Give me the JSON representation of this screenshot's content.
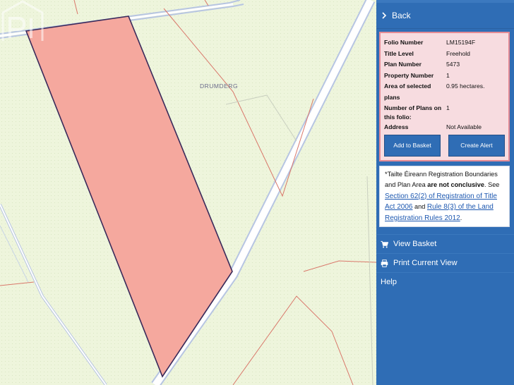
{
  "map": {
    "townland_label": "DRUMDERG",
    "colors": {
      "background": "#eef5dc",
      "plot_fill": "#f5a89e",
      "plot_border": "#3a2a5a",
      "road": "#b7c5e2",
      "boundary": "#d9776a"
    },
    "watermark_icon": "ppr-logo-watermark"
  },
  "panel": {
    "back_label": "Back",
    "folio": {
      "rows": [
        {
          "label": "Folio Number",
          "value": "LM15194F"
        },
        {
          "label": "Title Level",
          "value": "Freehold"
        },
        {
          "label": "Plan Number",
          "value": "5473"
        },
        {
          "label": "Property Number",
          "value": "1"
        },
        {
          "label": "Area of selected plans",
          "value": "0.95 hectares."
        },
        {
          "label": "Number of Plans on this folio:",
          "value": "1"
        },
        {
          "label": "Address",
          "value": "Not Available"
        }
      ],
      "add_to_basket": "Add to Basket",
      "create_alert": "Create Alert"
    },
    "notice": {
      "text_1": "*Tailte Éireann Registration Boundaries and Plan Area ",
      "bold": "are not conclusive",
      "text_2": ". See ",
      "link_1": "Section 62(2) of Registration of Title Act 2006",
      "text_3": " and ",
      "link_2": "Rule 8(3) of the Land Registration Rules 2012",
      "text_4": "."
    },
    "menu": {
      "view_basket": "View Basket",
      "print_view": "Print Current View",
      "help": "Help"
    },
    "colors": {
      "panel": "#2f6db5",
      "card_fill": "#f7dce0",
      "card_border": "#e48a94"
    }
  }
}
